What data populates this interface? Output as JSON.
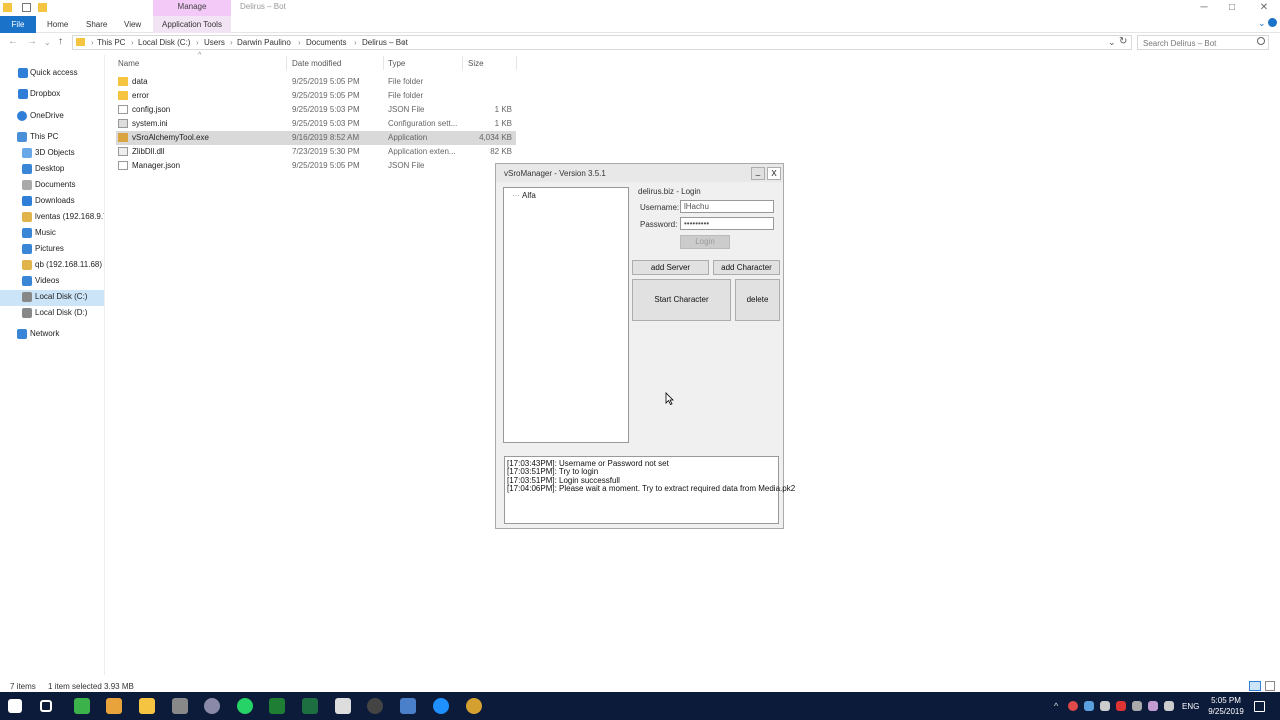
{
  "window": {
    "title": "Delirus – Bot",
    "manage_tab": "Manage",
    "minimize": "─",
    "maximize": "□",
    "close": "✕"
  },
  "ribbon": {
    "tabs": [
      "File",
      "Home",
      "Share",
      "View",
      "Application Tools"
    ]
  },
  "address": {
    "breadcrumbs": [
      "This PC",
      "Local Disk (C:)",
      "Users",
      "Darwin Paulino",
      "Documents",
      "Delirus – Bot"
    ],
    "search_placeholder": "Search Delirus – Bot"
  },
  "nav": {
    "items": [
      {
        "label": "Quick access",
        "icon": "star-icon",
        "color": "#2f7fd8"
      },
      {
        "label": "Dropbox",
        "icon": "dropbox-icon",
        "color": "#2f7fd8"
      },
      {
        "label": "OneDrive",
        "icon": "cloud-icon",
        "color": "#2f7fd8"
      },
      {
        "label": "This PC",
        "icon": "computer-icon",
        "color": "#4a90d9"
      },
      {
        "label": "3D Objects",
        "icon": "cube-icon",
        "color": "#6aa9e8"
      },
      {
        "label": "Desktop",
        "icon": "desktop-icon",
        "color": "#3a86d6"
      },
      {
        "label": "Documents",
        "icon": "document-icon",
        "color": "#aaaaaa"
      },
      {
        "label": "Downloads",
        "icon": "download-icon",
        "color": "#2f7fd8"
      },
      {
        "label": "lventas (192.168.9.7",
        "icon": "network-drive-icon",
        "color": "#e0b44a"
      },
      {
        "label": "Music",
        "icon": "music-icon",
        "color": "#3a86d6"
      },
      {
        "label": "Pictures",
        "icon": "picture-icon",
        "color": "#3a86d6"
      },
      {
        "label": "qb (192.168.11.68)",
        "icon": "network-drive-icon",
        "color": "#e0b44a"
      },
      {
        "label": "Videos",
        "icon": "video-icon",
        "color": "#3a86d6"
      },
      {
        "label": "Local Disk (C:)",
        "icon": "disk-icon",
        "color": "#888888"
      },
      {
        "label": "Local Disk (D:)",
        "icon": "disk-icon",
        "color": "#888888"
      },
      {
        "label": "Network",
        "icon": "network-icon",
        "color": "#3a86d6"
      }
    ]
  },
  "columns": [
    "Name",
    "Date modified",
    "Type",
    "Size"
  ],
  "files": [
    {
      "name": "data",
      "date": "9/25/2019 5:05 PM",
      "type": "File folder",
      "size": "",
      "icon": "folder-icon",
      "color": "#f5c542"
    },
    {
      "name": "error",
      "date": "9/25/2019 5:05 PM",
      "type": "File folder",
      "size": "",
      "icon": "folder-icon",
      "color": "#f5c542"
    },
    {
      "name": "config.json",
      "date": "9/25/2019 5:03 PM",
      "type": "JSON File",
      "size": "1 KB",
      "icon": "file-icon",
      "color": "#ffffff"
    },
    {
      "name": "system.ini",
      "date": "9/25/2019 5:03 PM",
      "type": "Configuration sett...",
      "size": "1 KB",
      "icon": "settings-file-icon",
      "color": "#dddddd"
    },
    {
      "name": "vSroAlchemyTool.exe",
      "date": "9/16/2019 8:52 AM",
      "type": "Application",
      "size": "4,034 KB",
      "icon": "exe-icon",
      "color": "#d9a441"
    },
    {
      "name": "ZlibDll.dll",
      "date": "7/23/2019 5:30 PM",
      "type": "Application exten...",
      "size": "82 KB",
      "icon": "dll-icon",
      "color": "#eeeeee"
    },
    {
      "name": "Manager.json",
      "date": "9/25/2019 5:05 PM",
      "type": "JSON File",
      "size": "",
      "icon": "file-icon",
      "color": "#ffffff"
    }
  ],
  "status": {
    "count": "7 items",
    "selected": "1 item selected  3.93 MB"
  },
  "vsro": {
    "title": "vSroManager - Version 3.5.1",
    "min": "_",
    "close": "X",
    "tree_item": "Alfa",
    "login_group": "delirus.biz - Login",
    "username_label": "Username:",
    "username_value": "lHachu",
    "password_label": "Password:",
    "password_value": "•••••••••",
    "login_button": "Login",
    "add_server": "add Server",
    "add_character": "add Character",
    "start_character": "Start Character",
    "delete": "delete",
    "log": [
      "[17:03:43PM]: Username or Password not set",
      "[17:03:51PM]: Try to login",
      "[17:03:51PM]: Login successfull",
      "[17:04:06PM]: Please wait a moment.  Try to extract required data from Media.pk2"
    ]
  },
  "taskbar": {
    "lang": "ENG",
    "time": "5:05 PM",
    "date": "9/25/2019"
  }
}
